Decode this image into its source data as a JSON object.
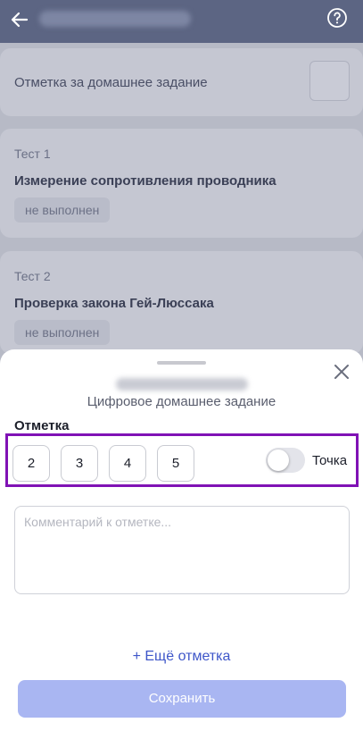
{
  "colors": {
    "accent": "#3e56c9",
    "save_button_bg": "#a9b6f2",
    "highlight_border": "#8012b5",
    "topbar": "#5c6583"
  },
  "topbar": {
    "back_icon": "arrow-left-icon",
    "help_icon": "question-circle-icon"
  },
  "homework": {
    "label": "Отметка за домашнее задание"
  },
  "tests": [
    {
      "name": "Тест 1",
      "title": "Измерение сопротивления проводника",
      "status": "не выполнен"
    },
    {
      "name": "Тест 2",
      "title": "Проверка закона Гей-Люссака",
      "status": "не выполнен"
    }
  ],
  "sheet": {
    "subtitle": "Цифровое домашнее задание",
    "mark_label": "Отметка",
    "grades": [
      "2",
      "3",
      "4",
      "5"
    ],
    "toggle_label": "Точка",
    "toggle_on": false,
    "comment_placeholder": "Комментарий к отметке...",
    "add_mark": "+ Ещё отметка",
    "save": "Сохранить",
    "close_icon": "close-icon"
  }
}
